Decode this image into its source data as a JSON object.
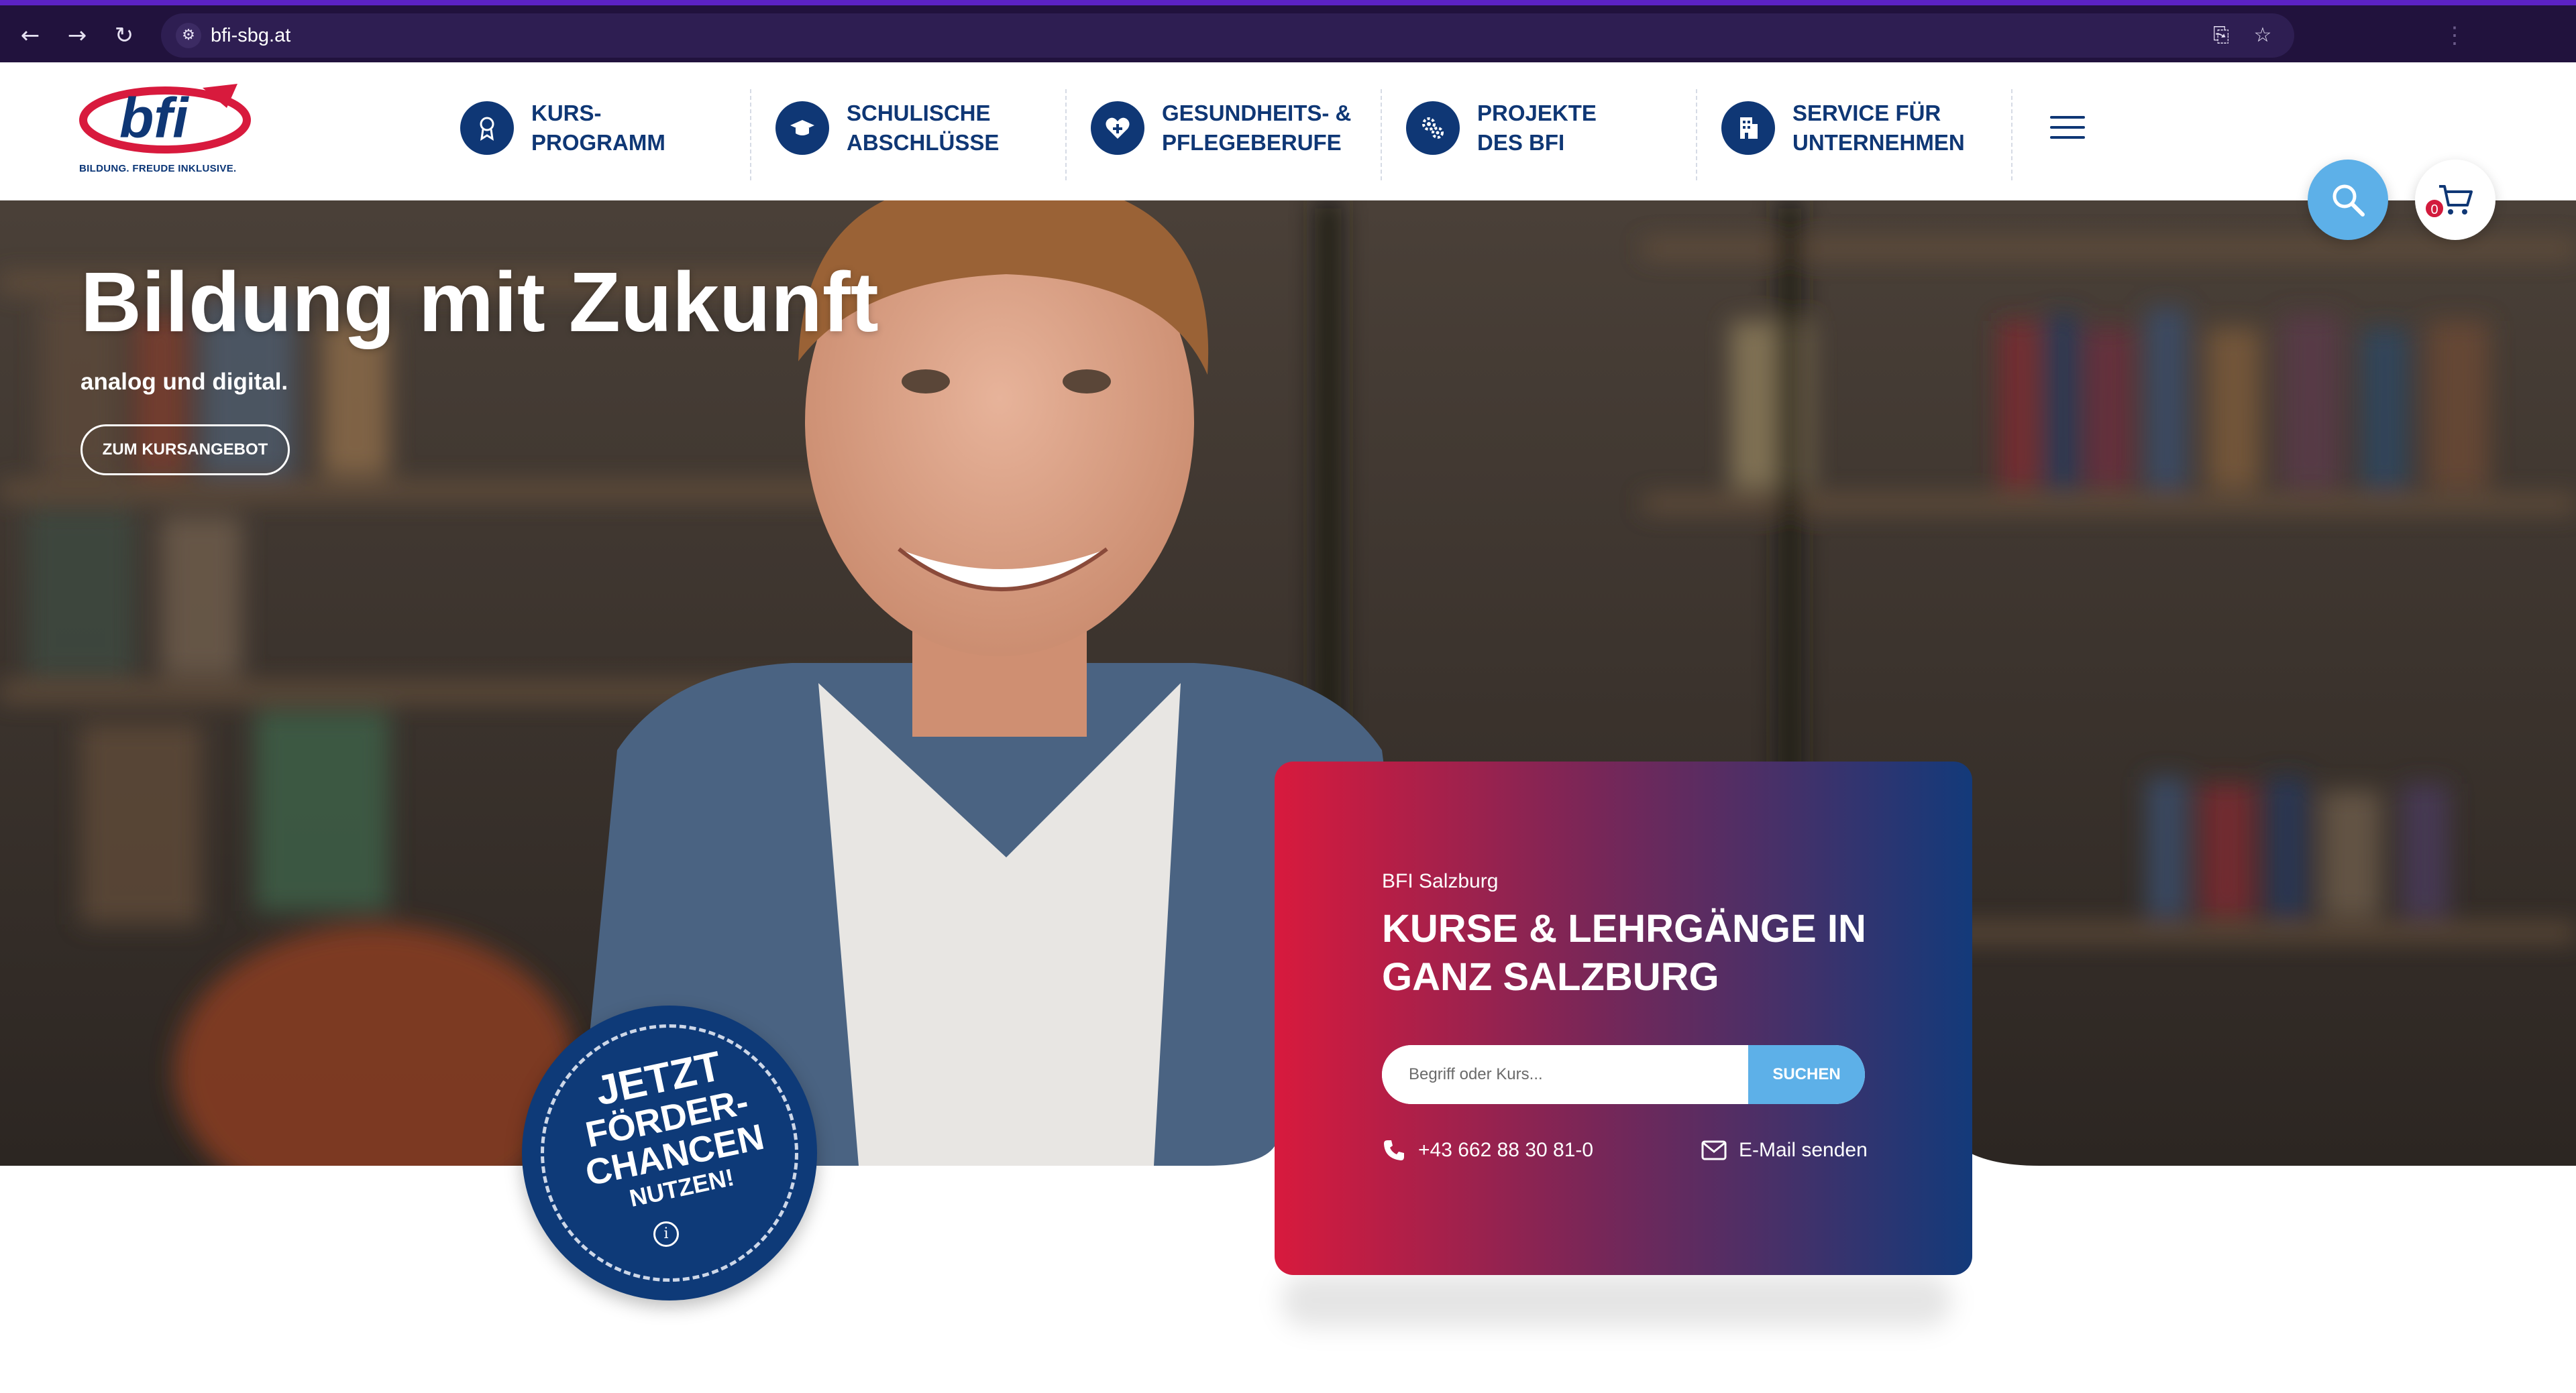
{
  "browser": {
    "url": "bfi-sbg.at",
    "icons": [
      "back-icon",
      "forward-icon",
      "reload-icon",
      "site-settings-icon",
      "install-app-icon",
      "bookmark-star-icon",
      "menu-dots-icon"
    ]
  },
  "header": {
    "logo_text": "bfi",
    "logo_tagline": "BILDUNG. FREUDE INKLUSIVE.",
    "nav": [
      {
        "label": "KURS-\nPROGRAMM",
        "icon": "award-icon"
      },
      {
        "label": "SCHULISCHE\nABSCHLÜSSE",
        "icon": "graduation-cap-icon"
      },
      {
        "label": "GESUNDHEITS- &\nPFLEGEBERUFE",
        "icon": "heart-plus-icon"
      },
      {
        "label": "PROJEKTE\nDES BFI",
        "icon": "gears-icon"
      },
      {
        "label": "SERVICE FÜR\nUNTERNEHMEN",
        "icon": "building-icon"
      }
    ],
    "menu_icon": "hamburger-menu-icon"
  },
  "hero": {
    "headline": "Bildung mit Zukunft",
    "subline": "analog und digital.",
    "cta": "ZUM KURSANGEBOT",
    "cart_count": "0"
  },
  "card": {
    "kicker": "BFI Salzburg",
    "title": "KURSE & LEHRGÄNGE IN\nGANZ SALZBURG",
    "search_placeholder": "Begriff oder Kurs...",
    "search_button": "SUCHEN",
    "phone": "+43 662 88 30 81-0",
    "email": "E-Mail senden"
  },
  "badge": {
    "line1": "JETZT",
    "line2": "FÖRDER-",
    "line3": "CHANCEN",
    "line4": "NUTZEN!"
  },
  "colors": {
    "brand_blue": "#0f3775",
    "brand_red": "#d81a3d",
    "accent_light_blue": "#5db0e8",
    "browser_frame": "#21123d"
  }
}
